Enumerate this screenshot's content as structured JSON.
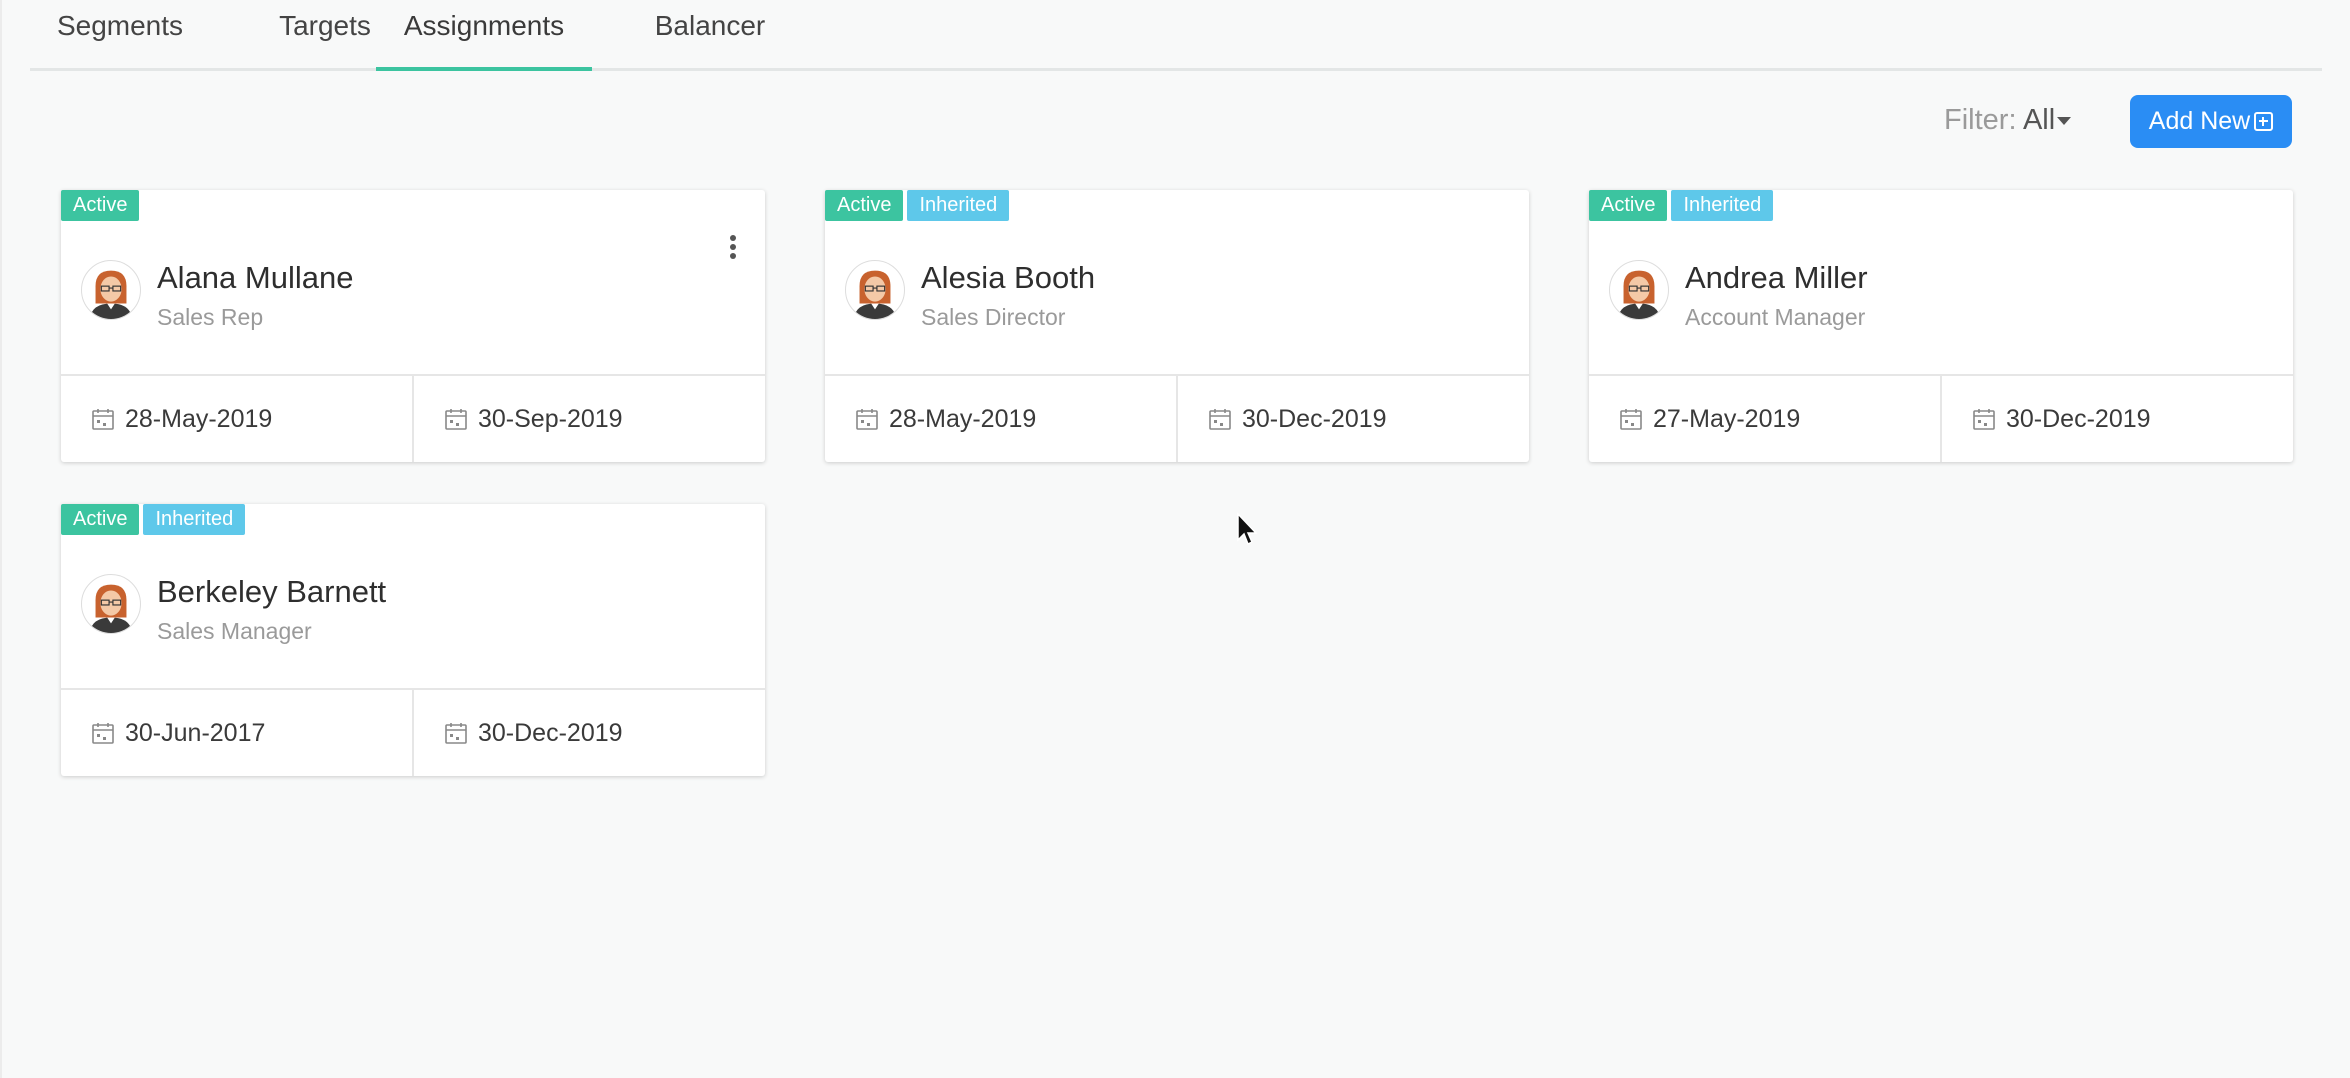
{
  "tabs": [
    {
      "label": "Segments"
    },
    {
      "label": "Targets"
    },
    {
      "label": "Assignments"
    },
    {
      "label": "Balancer"
    }
  ],
  "active_tab": "Assignments",
  "toolbar": {
    "filter_label": "Filter:",
    "filter_value": "All",
    "add_new_label": "Add New"
  },
  "cards": [
    {
      "name": "Alana Mullane",
      "role": "Sales Rep",
      "badges": [
        "Active"
      ],
      "start_date": "28-May-2019",
      "end_date": "30-Sep-2019"
    },
    {
      "name": "Alesia Booth",
      "role": "Sales Director",
      "badges": [
        "Active",
        "Inherited"
      ],
      "start_date": "28-May-2019",
      "end_date": "30-Dec-2019"
    },
    {
      "name": "Andrea Miller",
      "role": "Account Manager",
      "badges": [
        "Active",
        "Inherited"
      ],
      "start_date": "27-May-2019",
      "end_date": "30-Dec-2019"
    },
    {
      "name": "Berkeley Barnett",
      "role": "Sales Manager",
      "badges": [
        "Active",
        "Inherited"
      ],
      "start_date": "30-Jun-2017",
      "end_date": "30-Dec-2019"
    }
  ],
  "colors": {
    "accent": "#3cc4a0",
    "primary_button": "#2a8df4",
    "badge_active": "#3cc4a0",
    "badge_inherited": "#5ec8ea"
  },
  "icons": {
    "date": "calendar-icon",
    "menu": "kebab-menu-icon",
    "add": "plus-square-icon",
    "avatar": "avatar-icon"
  }
}
